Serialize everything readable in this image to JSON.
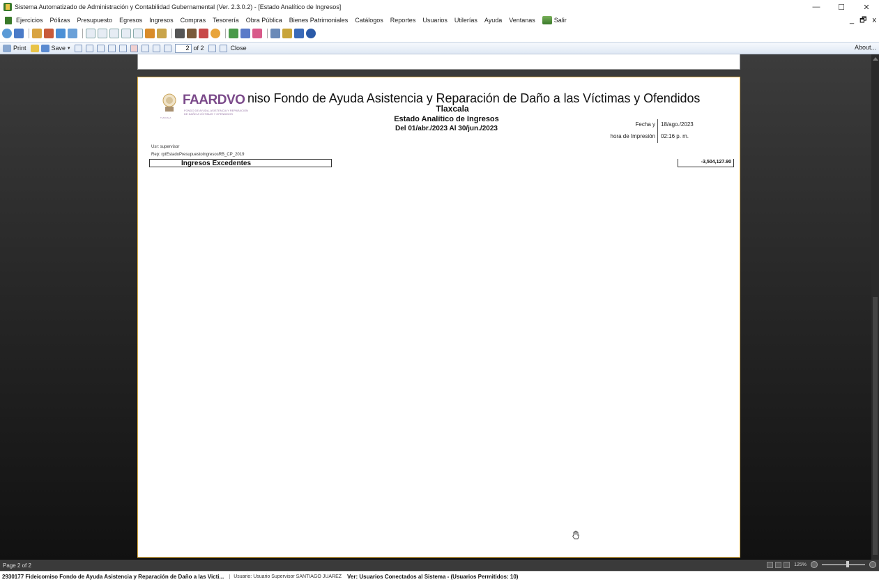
{
  "window": {
    "title": "Sistema Automatizado de Administración y Contabilidad Gubernamental (Ver. 2.3.0.2) - [Estado Analítico de Ingresos]",
    "minimize": "—",
    "maximize": "☐",
    "close": "✕",
    "mdi_minimize": "_",
    "mdi_restore": "🗗",
    "mdi_close": "x"
  },
  "menu": {
    "items": [
      "Ejercicios",
      "Pólizas",
      "Presupuesto",
      "Egresos",
      "Ingresos",
      "Compras",
      "Tesorería",
      "Obra Pública",
      "Bienes Patrimoniales",
      "Catálogos",
      "Reportes",
      "Usuarios",
      "Utilerías",
      "Ayuda",
      "Ventanas"
    ],
    "salir": "Salir"
  },
  "report_toolbar": {
    "print": "Print",
    "save": "Save",
    "page_value": "2",
    "page_of": "of 2",
    "close": "Close",
    "about": "About..."
  },
  "report": {
    "logo_name": "FAARDVO",
    "logo_line1": "FONDO DE AYUDA, ASISTENCIA Y REPARACIÓN",
    "logo_line2": "DE DAÑO A VÍCTIMAS Y OFENDIDOS",
    "logo_line0": "TLAXCALA",
    "title": "niso Fondo de Ayuda Asistencia y Reparación de Daño a las Víctimas y Ofendidos",
    "subtitle1": "Tlaxcala",
    "subtitle2": "Estado Analítico de Ingresos",
    "subtitle3": "Del 01/abr./2023 Al 30/jun./2023",
    "fecha_label": "Fecha y",
    "fecha_value": "18/ago./2023",
    "hora_label": "hora de Impresión",
    "hora_value": "02:16 p. m.",
    "usr": "Usr: supervisor",
    "rep": "Rep: rptEstadoPresupuestoIngresosRB_CP_2019",
    "ingresos_label": "Ingresos Excedentes",
    "ingresos_amount": "-3,504,127.90"
  },
  "status": {
    "page": "Page 2 of 2",
    "zoom": "125%"
  },
  "bottom": {
    "main": "2930177 Fideicomiso Fondo de Ayuda Asistencia y Reparación de Daño a las Victi...",
    "user": "Usuario: Usuario Supervisor SANTIAGO JUAREZ",
    "conn": "Ver: Usuarios Conectados al Sistema - (Usuarios Permitidos: 10)"
  },
  "colors": {
    "page_border": "#e8b84a",
    "logo": "#7b4a8a",
    "viewer_bg": "#2e2e2e"
  }
}
